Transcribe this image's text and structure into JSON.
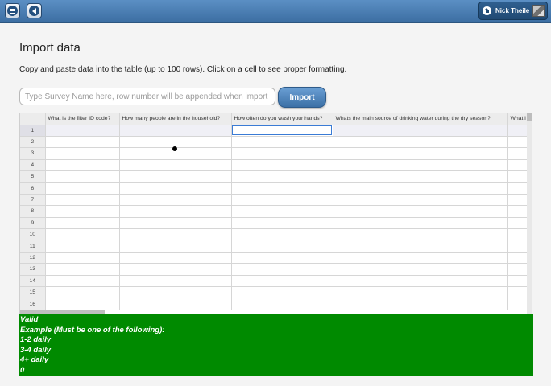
{
  "header": {
    "user_name": "Nick Theile"
  },
  "page": {
    "title": "Import data",
    "description": "Copy and paste data into the table (up to 100 rows). Click on a cell to see proper formatting."
  },
  "form": {
    "survey_placeholder": "Type Survey Name here, row number will be appended when import",
    "import_label": "Import"
  },
  "table": {
    "columns": [
      "What is the filter ID code?",
      "How many people are in the household?",
      "How often do you wash your hands?",
      "Whats the main source of drinking water during the dry season?",
      "What i"
    ],
    "row_numbers": [
      "1",
      "2",
      "3",
      "4",
      "5",
      "6",
      "7",
      "8",
      "9",
      "10",
      "11",
      "12",
      "13",
      "14",
      "15",
      "16"
    ],
    "selected_cell": {
      "row": 1,
      "column": 3
    }
  },
  "validation": {
    "status": "Valid",
    "example_heading": "Example (Must be one of the following):",
    "options": [
      "1-2 daily",
      "3-4 daily",
      "4+ daily",
      "0"
    ],
    "background_color": "#008a00"
  },
  "colors": {
    "topbar": "#4a7fb5",
    "accent": "#3c70a6"
  }
}
